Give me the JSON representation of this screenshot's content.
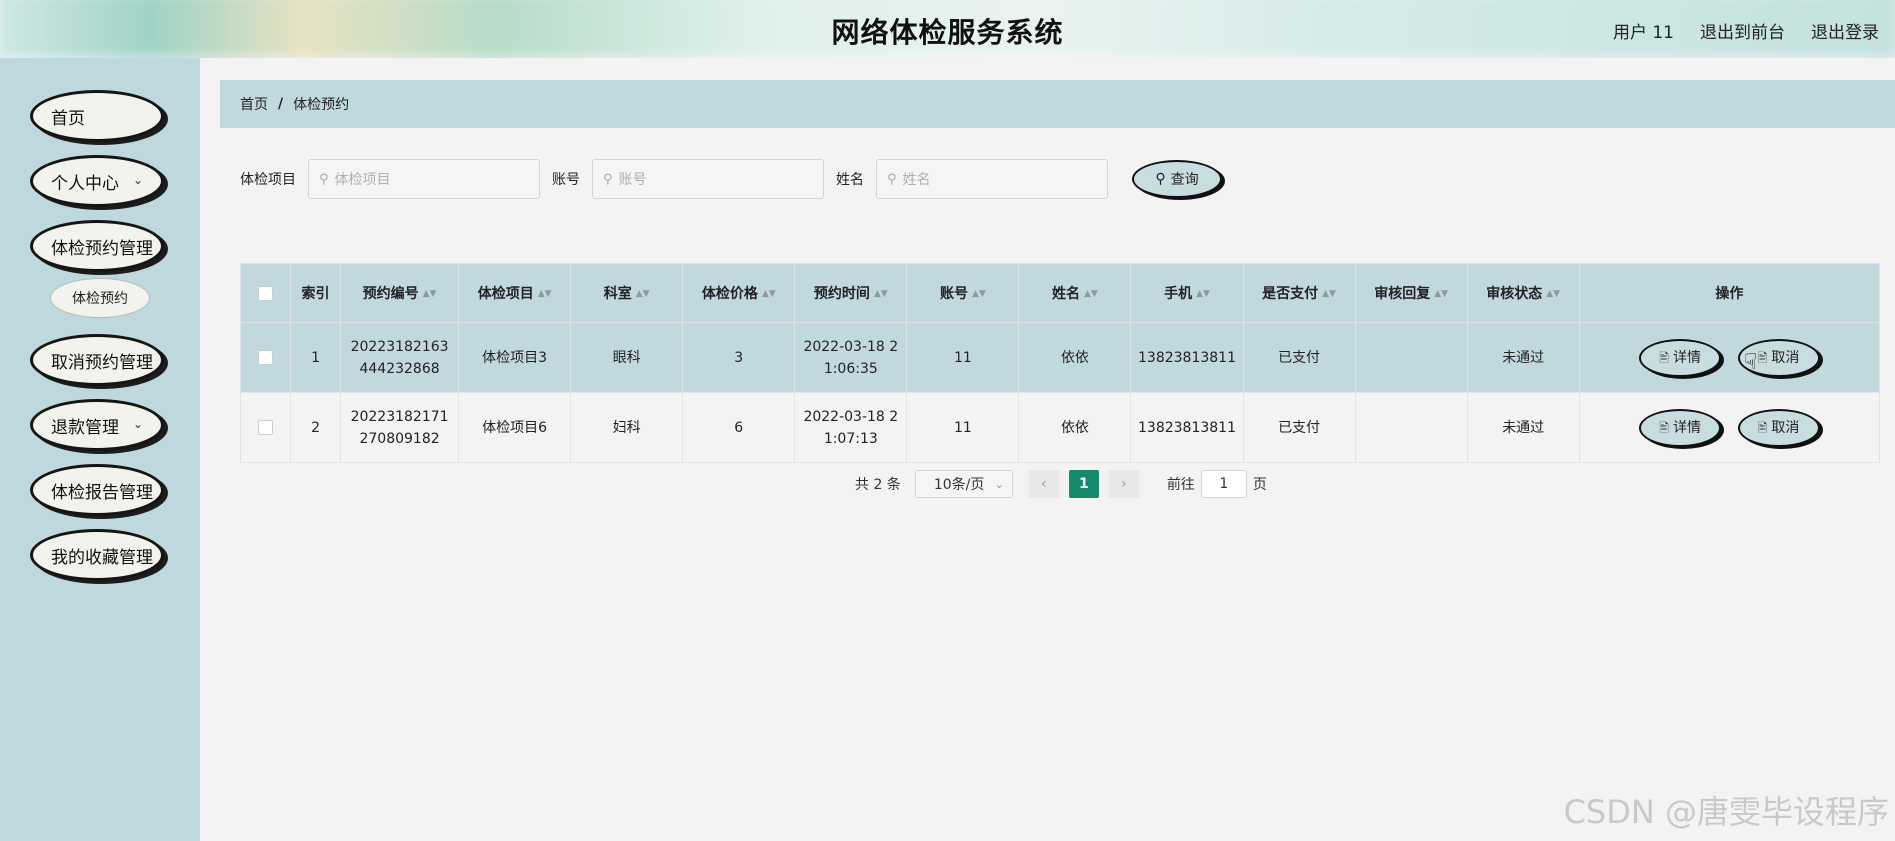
{
  "header": {
    "title": "网络体检服务系统",
    "user": "用户 11",
    "back_frontend": "退出到前台",
    "logout": "退出登录"
  },
  "sidebar": {
    "items": [
      {
        "label": "首页"
      },
      {
        "label": "个人中心"
      },
      {
        "label": "体检预约管理"
      },
      {
        "label": "体检预约"
      },
      {
        "label": "取消预约管理"
      },
      {
        "label": "退款管理"
      },
      {
        "label": "体检报告管理"
      },
      {
        "label": "我的收藏管理"
      }
    ]
  },
  "breadcrumb": {
    "home": "首页",
    "sep": "/",
    "current": "体检预约"
  },
  "search": {
    "project_label": "体检项目",
    "project_placeholder": "体检项目",
    "account_label": "账号",
    "account_placeholder": "账号",
    "name_label": "姓名",
    "name_placeholder": "姓名",
    "query_button": "查询"
  },
  "table": {
    "headers": [
      "索引",
      "预约编号",
      "体检项目",
      "科室",
      "体检价格",
      "预约时间",
      "账号",
      "姓名",
      "手机",
      "是否支付",
      "审核回复",
      "审核状态",
      "操作"
    ],
    "rows": [
      {
        "index": "1",
        "order_line1": "20223182163",
        "order_line2": "444232868",
        "project": "体检项目3",
        "dept": "眼科",
        "price": "3",
        "time_line1": "2022-03-18 2",
        "time_line2": "1:06:35",
        "account": "11",
        "name": "依依",
        "phone": "13823813811",
        "paid": "已支付",
        "reply": "",
        "status": "未通过"
      },
      {
        "index": "2",
        "order_line1": "20223182171",
        "order_line2": "270809182",
        "project": "体检项目6",
        "dept": "妇科",
        "price": "6",
        "time_line1": "2022-03-18 2",
        "time_line2": "1:07:13",
        "account": "11",
        "name": "依依",
        "phone": "13823813811",
        "paid": "已支付",
        "reply": "",
        "status": "未通过"
      }
    ],
    "detail_button": "详情",
    "cancel_button": "取消"
  },
  "pagination": {
    "total": "共 2 条",
    "page_size": "10条/页",
    "current_page": "1",
    "goto_label": "前往",
    "goto_value": "1",
    "page_suffix": "页"
  },
  "watermark": "CSDN @唐雯毕设程序",
  "colors": {
    "accent": "#158a6c",
    "panel": "#c1d9dd"
  }
}
